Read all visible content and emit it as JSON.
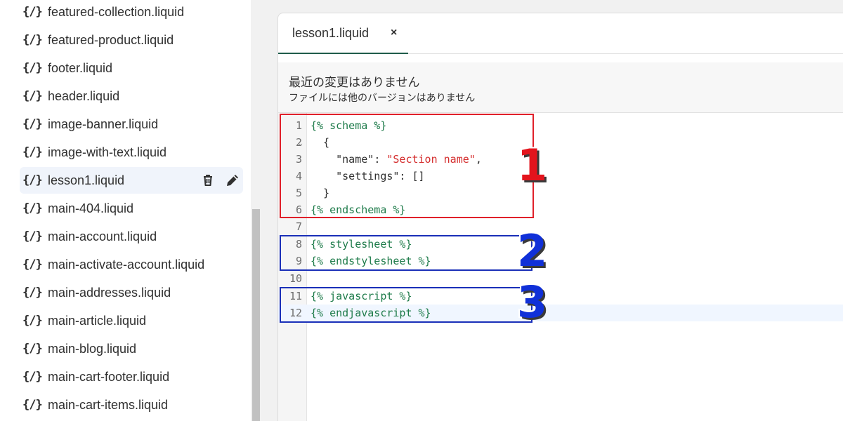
{
  "sidebar": {
    "icon_glyph": "{/}",
    "files": [
      {
        "label": "featured-collection.liquid"
      },
      {
        "label": "featured-product.liquid"
      },
      {
        "label": "footer.liquid"
      },
      {
        "label": "header.liquid"
      },
      {
        "label": "image-banner.liquid"
      },
      {
        "label": "image-with-text.liquid"
      },
      {
        "label": "lesson1.liquid",
        "active": true,
        "actions": [
          "trash-icon",
          "pencil-icon"
        ]
      },
      {
        "label": "main-404.liquid"
      },
      {
        "label": "main-account.liquid"
      },
      {
        "label": "main-activate-account.liquid"
      },
      {
        "label": "main-addresses.liquid"
      },
      {
        "label": "main-article.liquid"
      },
      {
        "label": "main-blog.liquid"
      },
      {
        "label": "main-cart-footer.liquid"
      },
      {
        "label": "main-cart-items.liquid"
      }
    ]
  },
  "editor": {
    "tab": {
      "label": "lesson1.liquid",
      "close": "×"
    },
    "notice": {
      "title": "最近の変更はありません",
      "subtitle": "ファイルには他のバージョンはありません"
    },
    "lines": [
      {
        "n": "1",
        "text": "{% schema %}"
      },
      {
        "n": "2",
        "text": "  {"
      },
      {
        "n": "3",
        "text": "    \"name\": \"Section name\","
      },
      {
        "n": "4",
        "text": "    \"settings\": []"
      },
      {
        "n": "5",
        "text": "  }"
      },
      {
        "n": "6",
        "text": "{% endschema %}"
      },
      {
        "n": "7",
        "text": ""
      },
      {
        "n": "8",
        "text": "{% stylesheet %}"
      },
      {
        "n": "9",
        "text": "{% endstylesheet %}"
      },
      {
        "n": "10",
        "text": ""
      },
      {
        "n": "11",
        "text": "{% javascript %}"
      },
      {
        "n": "12",
        "text": "{% endjavascript %}"
      }
    ],
    "active_line": "12",
    "fold_marker": "⌄"
  },
  "annotations": [
    {
      "label": "1",
      "color": "#e3141d"
    },
    {
      "label": "2",
      "color": "#1030d8"
    },
    {
      "label": "3",
      "color": "#1030d8"
    }
  ]
}
